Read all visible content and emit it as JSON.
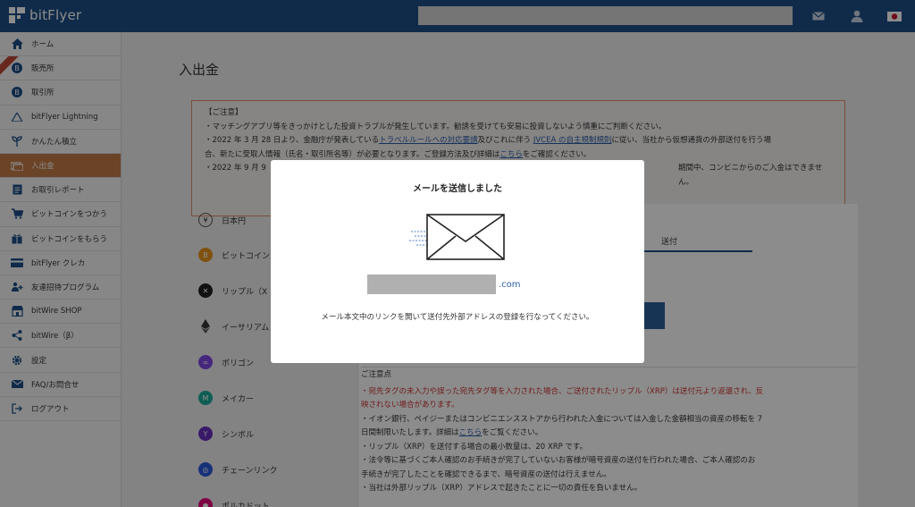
{
  "header": {
    "logo_text": "bitFlyer",
    "icons": [
      "mail-icon",
      "user-icon",
      "japan-flag-icon"
    ]
  },
  "sidebar": {
    "items": [
      {
        "label": "ホーム",
        "icon": "home-icon"
      },
      {
        "label": "販売所",
        "icon": "bitcoin-icon"
      },
      {
        "label": "取引所",
        "icon": "bitcoin-icon"
      },
      {
        "label": "bitFlyer Lightning",
        "icon": "lightning-icon"
      },
      {
        "label": "かんたん積立",
        "icon": "plant-icon"
      },
      {
        "label": "入出金",
        "icon": "money-icon"
      },
      {
        "label": "お取引レポート",
        "icon": "report-icon"
      },
      {
        "label": "ビットコインをつかう",
        "icon": "cart-icon"
      },
      {
        "label": "ビットコインをもらう",
        "icon": "gift-icon"
      },
      {
        "label": "bitFlyer クレカ",
        "icon": "card-icon"
      },
      {
        "label": "友達招待プログラム",
        "icon": "invite-icon"
      },
      {
        "label": "bitWire SHOP",
        "icon": "shop-icon"
      },
      {
        "label": "bitWire（β）",
        "icon": "share-icon"
      },
      {
        "label": "設定",
        "icon": "gear-icon"
      },
      {
        "label": "FAQ/お問合せ",
        "icon": "mail-icon"
      },
      {
        "label": "ログアウト",
        "icon": "logout-icon"
      }
    ],
    "active_index": 5,
    "accent_color": "#c47a45"
  },
  "main": {
    "page_title": "入出金",
    "notice": {
      "heading": "【ご注意】",
      "line1": "・マッチングアプリ等をきっかけとした投資トラブルが発生しています。勧誘を受けても安易に投資しないよう慎重にご判断ください。",
      "line2_a": "・2022 年 3 月 28 日より、金融庁が発表している",
      "line2_link1": "トラベルルールへの対応要請",
      "line2_b": "及びこれに伴う ",
      "line2_link2": "JVCEA の自主規制規則",
      "line2_c": "に従い、当社から仮想通貨の外部送付を行う場",
      "line3_a": "合、新たに受取人情報（氏名・取引所名等）が必要となります。ご登録方法及び詳細は",
      "line3_link": "こちら",
      "line3_b": "をご確認ください。",
      "line4_a": "・2022 年 9 月 9",
      "line4_b": "期間中、コンビニからのご入金はできません。"
    },
    "coins": [
      {
        "label": "日本円",
        "icon": "yen-icon",
        "color": "#ffffff"
      },
      {
        "label": "ビットコイン",
        "icon": "bitcoin-icon",
        "color": "#e8961e"
      },
      {
        "label": "リップル（X",
        "icon": "xrp-icon",
        "color": "#222222"
      },
      {
        "label": "イーサリアム",
        "icon": "ethereum-icon",
        "color": "#ffffff"
      },
      {
        "label": "ポリゴン",
        "icon": "polygon-icon",
        "color": "#8247e5"
      },
      {
        "label": "メイカー",
        "icon": "maker-icon",
        "color": "#1aab9b"
      },
      {
        "label": "シンボル",
        "icon": "symbol-icon",
        "color": "#6b2fbf"
      },
      {
        "label": "チェーンリンク",
        "icon": "chainlink-icon",
        "color": "#2a5ada"
      },
      {
        "label": "ポルカドット",
        "icon": "polkadot-icon",
        "color": "#e6007a"
      }
    ],
    "tab_send": "送付",
    "caution": {
      "title": "ご注意点",
      "red_line1": "・宛先タグの未入力や誤った宛先タグ等を入力された場合、ご送付されたリップル（XRP）は送付元より返還され、反",
      "red_line2": "映されない場合があります。",
      "line3": "・イオン銀行、ペイジーまたはコンビニエンスストアから行われた入金については入金した金額相当の資産の移転を 7",
      "line4_a": "日間制限いたします。詳細は",
      "line4_link": "こちら",
      "line4_b": "をご覧ください。",
      "line5": "・リップル（XRP）を送付する場合の最小数量は、20 XRP です。",
      "line6": "・法令等に基づくご本人確認のお手続きが完了していないお客様が暗号資産の送付を行われた場合、ご本人確認のお",
      "line7": "手続きが完了したことを確認できるまで、暗号資産の送付は行えません。",
      "line8": "・当社は外部リップル（XRP）アドレスで起きたことに一切の責任を負いません。"
    }
  },
  "modal": {
    "title": "メールを送信しました",
    "email_domain": ".com",
    "message": "メール本文中のリンクを開いて送付先外部アドレスの登録を行なってください。"
  }
}
